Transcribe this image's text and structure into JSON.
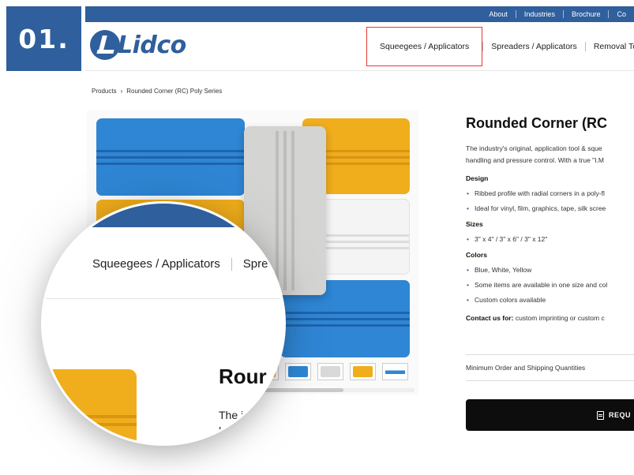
{
  "step": {
    "label": "01."
  },
  "topbar": {
    "links": [
      "About",
      "Industries",
      "Brochure",
      "Co"
    ]
  },
  "logo": {
    "text": "Lidco"
  },
  "nav": {
    "items": [
      "Squeegees / Applicators",
      "Spreaders / Applicators",
      "Removal To"
    ]
  },
  "breadcrumb": {
    "items": [
      "Products",
      "›",
      "Rounded Corner (RC) Poly Series"
    ]
  },
  "product": {
    "title": "Rounded Corner (RC",
    "desc_line1": "The industry's original, application tool & sque",
    "desc_line2": "handling and pressure control. With a true \"I.M",
    "design_heading": "Design",
    "design_items": [
      "Ribbed profile with radial corners in a poly-fl",
      "Ideal for vinyl, film, graphics, tape, silk scree"
    ],
    "sizes_heading": "Sizes",
    "sizes_items": [
      "3\" x 4\" / 3\" x 6\" / 3\" x 12\""
    ],
    "colors_heading": "Colors",
    "colors_items": [
      "Blue, White, Yellow",
      "Some items are available in one size and col",
      "Custom colors available"
    ],
    "contact_label": "Contact us for:",
    "contact_text": " custom imprinting or custom c",
    "min_order": "Minimum Order and Shipping Quantities",
    "request_label": "REQU"
  },
  "magnifier": {
    "nav_item1": "Squeegees / Applicators",
    "nav_item2": "Spre",
    "title": "Rour",
    "desc_line1": "The i",
    "desc_line2": "h"
  },
  "colors": {
    "brand_blue": "#2f5f9c",
    "highlight_red": "#e53935",
    "product_blue": "#2f86d4",
    "product_yellow": "#f0ad1c"
  }
}
